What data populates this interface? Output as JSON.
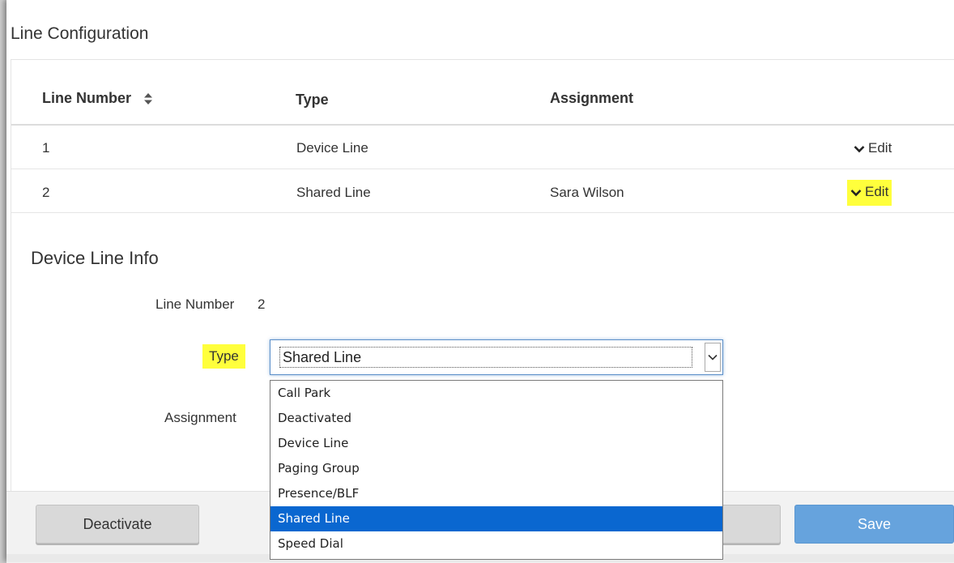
{
  "panel": {
    "title": "Line Configuration"
  },
  "table": {
    "headers": {
      "line_number": "Line Number",
      "type": "Type",
      "assignment": "Assignment"
    },
    "rows": [
      {
        "line_number": "1",
        "type": "Device Line",
        "assignment": "",
        "action": "Edit"
      },
      {
        "line_number": "2",
        "type": "Shared Line",
        "assignment": "Sara Wilson",
        "action": "Edit"
      }
    ]
  },
  "details": {
    "title": "Device Line Info",
    "line_number_label": "Line Number",
    "line_number_value": "2",
    "type_label": "Type",
    "assignment_label": "Assignment"
  },
  "type_select": {
    "value": "Shared Line",
    "options": [
      "Call Park",
      "Deactivated",
      "Device Line",
      "Paging Group",
      "Presence/BLF",
      "Shared Line",
      "Speed Dial"
    ]
  },
  "footer": {
    "deactivate_label": "Deactivate",
    "save_label": "Save"
  },
  "colors": {
    "highlight": "#ffff3c",
    "selected_option": "#0a67d0",
    "primary_button": "#66a3dd"
  }
}
